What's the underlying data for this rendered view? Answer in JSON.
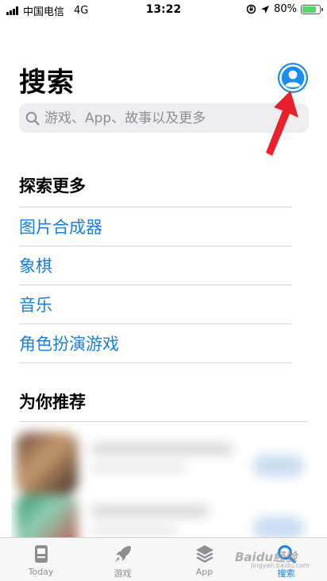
{
  "status_bar": {
    "carrier": "中国电信",
    "network": "4G",
    "time": "13:22",
    "battery": "80%",
    "battery_level": 0.8
  },
  "header": {
    "title": "搜索",
    "account_icon": "person-circle-icon"
  },
  "search": {
    "placeholder": "游戏、App、故事以及更多"
  },
  "explore": {
    "title": "探索更多",
    "items": [
      {
        "label": "图片合成器"
      },
      {
        "label": "象棋"
      },
      {
        "label": "音乐"
      },
      {
        "label": "角色扮演游戏"
      }
    ]
  },
  "recommend": {
    "title": "为你推荐"
  },
  "tab_bar": {
    "tabs": [
      {
        "label": "Today",
        "icon": "today-icon"
      },
      {
        "label": "游戏",
        "icon": "rocket-icon"
      },
      {
        "label": "App",
        "icon": "stack-icon"
      },
      {
        "label": "搜索",
        "icon": "search-icon",
        "active": true
      }
    ]
  },
  "watermark": {
    "text": "Baidu经验",
    "sub": "jingyan.baidu.com"
  },
  "colors": {
    "accent": "#1780e6",
    "annotation_arrow": "#e8202a"
  }
}
